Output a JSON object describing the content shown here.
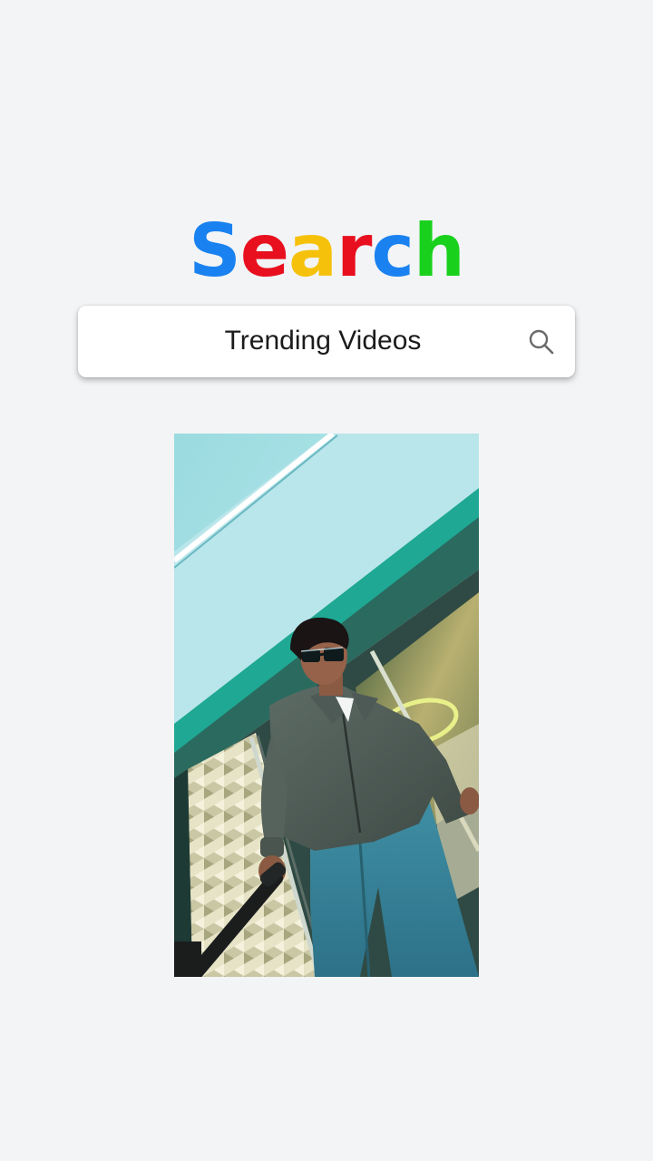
{
  "logo": {
    "letters": [
      "S",
      "e",
      "a",
      "r",
      "c",
      "h"
    ],
    "colors": [
      "#1a82f0",
      "#e8101e",
      "#f6c10a",
      "#e8101e",
      "#1a82f0",
      "#19d11c"
    ]
  },
  "search": {
    "query": "Trending Videos",
    "icon": "magnifier"
  },
  "video": {
    "subject": "man in sunglasses on escalator"
  }
}
